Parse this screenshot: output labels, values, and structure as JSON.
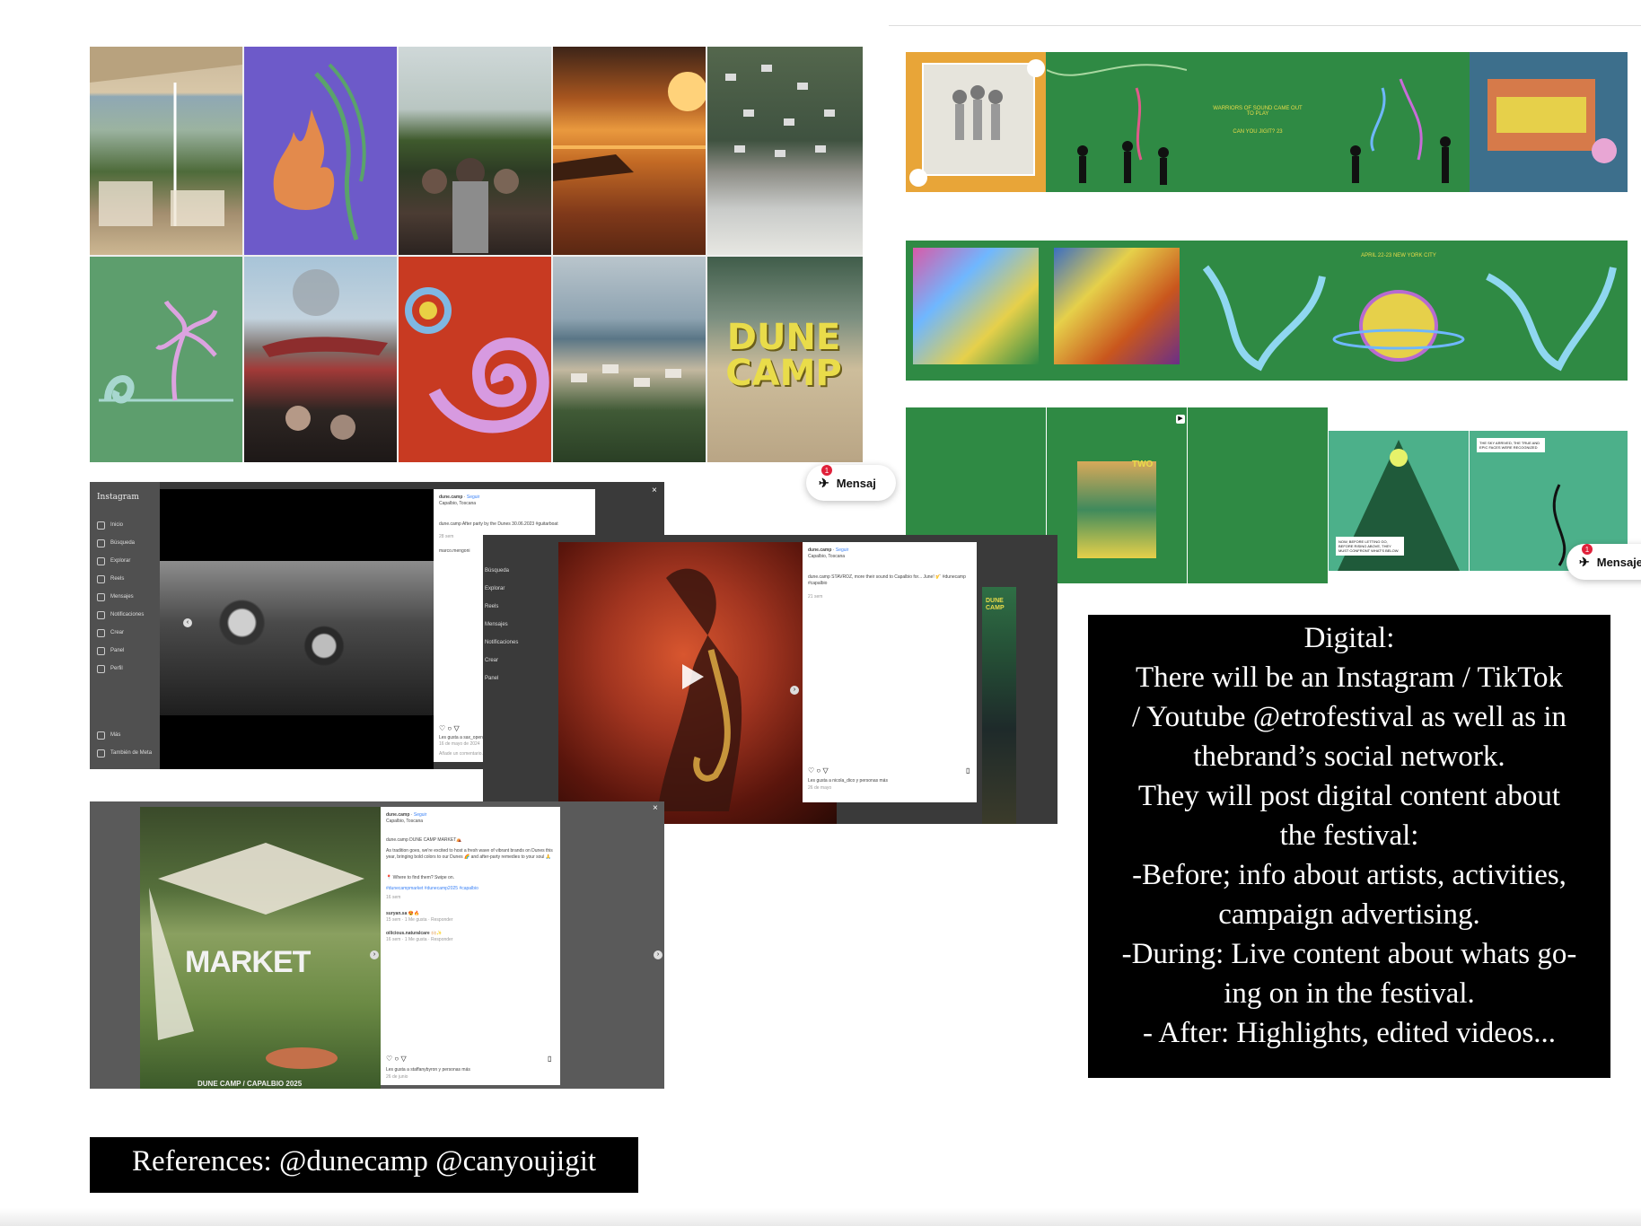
{
  "mentions": {
    "references": "References: @dunecamp @canyoujigit"
  },
  "digital_box": {
    "lines": [
      "Digital:",
      "There will be an Instagram / TikTok",
      "/ Youtube @etrofestival as well as in",
      "thebrand’s social network.",
      "They will post digital content about",
      "the festival:",
      "-Before; info about artists, activities,",
      "campaign advertising.",
      "-During: Live content about whats go-",
      "ing on in the festival.",
      "- After: Highlights, edited videos..."
    ]
  },
  "dune_grid": {
    "logo_text": "DUNE CAMP",
    "messages_pill": "Mensaj",
    "badge": "1"
  },
  "jigit_grid": {
    "row1_text_a": "WARRIORS OF SOUND CAME OUT TO PLAY",
    "row1_text_b": "CAN YOU JIGIT? 23",
    "row2_text": "APRIL 22-23 NEW YORK CITY",
    "row3_text_a": "NOW, BEFORE LETTING GO, BEFORE RISING ABOVE, THEY MUST CONFRONT WHAT'S BELOW.",
    "row3_text_b": "THE SKY ARRIVED, THE TRUE AND EPIC FACES WERE RECOGNIZED",
    "row3_poster_word": "TWO",
    "messages_pill": "Mensajes",
    "badge": "1"
  },
  "ig_post_1": {
    "app_name": "Instagram",
    "nav": [
      "Inicio",
      "Búsqueda",
      "Explorar",
      "Reels",
      "Mensajes",
      "Notificaciones",
      "Crear",
      "Panel",
      "Perfil"
    ],
    "nav_bottom": [
      "Más",
      "También de Meta"
    ],
    "account": "dune.camp",
    "follow": "Seguir",
    "location": "Capalbio, Toscana",
    "caption": "dune.camp After party by the Dunes 30.06.2023 #guitarboat",
    "caption_time": "28 sem",
    "comment_user": "marco.mengoni",
    "likes": "Les gusta a sax_open",
    "date": "16 de mayo de 2024",
    "add_comment": "Añade un comentario..."
  },
  "ig_post_2": {
    "account": "dune.camp",
    "follow": "Seguir",
    "location": "Capalbio, Toscana",
    "caption": "dune.camp STAVROZ, more their sound to Capalbio for... June! 🎷 #dunecamp #capalbio",
    "caption_time": "21 sem",
    "likes": "Les gusta a nicola_dico y personas más",
    "date": "26 de mayo",
    "partial_nav": [
      "Búsqueda",
      "Explorar",
      "Reels",
      "Mensajes",
      "Notificaciones",
      "Crear",
      "Panel"
    ],
    "side_text": "DUNE CAMP"
  },
  "ig_post_3": {
    "overlay_title": "MARKET",
    "overlay_footer": "DUNE CAMP / CAPALBIO 2025",
    "account": "dune.camp",
    "follow": "Seguir",
    "location": "Capalbio, Toscana",
    "caption_title": "dune.camp DUNE CAMP MARKET⛺",
    "caption_body": "As tradition goes, we're excited to host a fresh wave of vibrant brands on Dunes this year, bringing bold colors to our Dunes 🌈 and after-party remedies to your soul 🙏",
    "caption_where": "📍 Where to find them? Swipe on.",
    "hashtags": "#dunecampmarket #dunecamp2025 #capalbio",
    "caption_time": "16 sem",
    "comments": [
      {
        "user": "suryan.sa",
        "text": "😍🔥",
        "meta": "15 sem · 1 Me gusta · Responder"
      },
      {
        "user": "oilicious.naturalcare",
        "text": "🙌🏻✨",
        "meta": "16 sem · 1 Me gusta · Responder"
      }
    ],
    "likes": "Les gusta a staffanybyron y personas más",
    "date": "26 de junio"
  },
  "colors": {
    "jigit_green": "#2f8a44",
    "dune_purple": "#6d5ac9",
    "dune_red": "#c83a22",
    "dune_green": "#5d9e6d",
    "orange_shape": "#e38a4c",
    "pink_shape": "#d79ae0",
    "dune_yellow": "#e9dc4a"
  }
}
